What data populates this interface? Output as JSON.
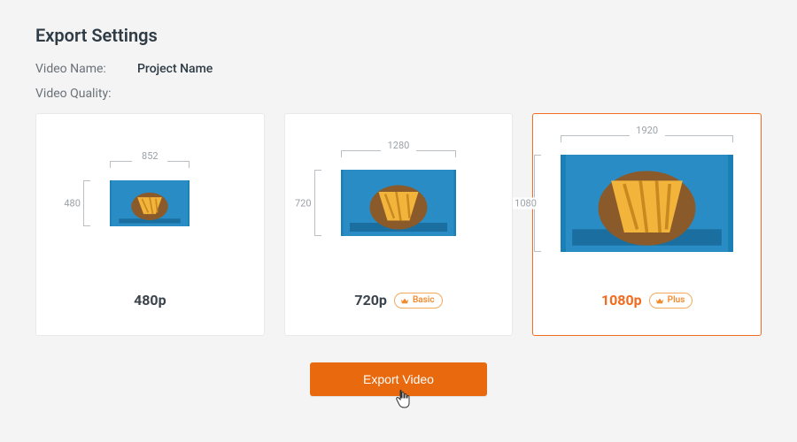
{
  "title": "Export Settings",
  "videoNameLabel": "Video Name:",
  "videoNameValue": "Project Name",
  "videoQualityLabel": "Video Quality:",
  "options": [
    {
      "label": "480p",
      "width": "852",
      "height": "480",
      "badge": null,
      "selected": false
    },
    {
      "label": "720p",
      "width": "1280",
      "height": "720",
      "badge": "Basic",
      "selected": false
    },
    {
      "label": "1080p",
      "width": "1920",
      "height": "1080",
      "badge": "Plus",
      "selected": true
    }
  ],
  "exportButton": "Export Video"
}
